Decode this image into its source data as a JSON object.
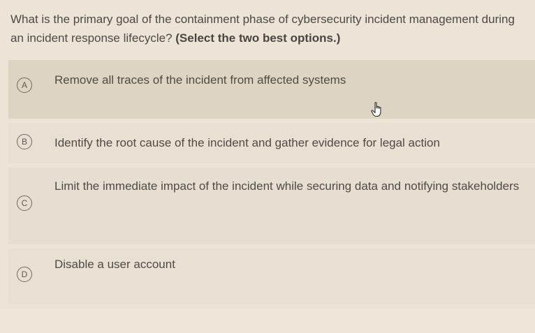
{
  "question": {
    "text": "What is the primary goal of the containment phase of cybersecurity incident management during an incident response lifecycle?",
    "hint": "(Select the two best options.)"
  },
  "options": [
    {
      "letter": "A",
      "text": "Remove all traces of the incident from affected systems"
    },
    {
      "letter": "B",
      "text": "Identify the root cause of the incident and gather evidence for legal action"
    },
    {
      "letter": "C",
      "text": "Limit the immediate impact of the incident while securing data and notifying stakeholders"
    },
    {
      "letter": "D",
      "text": "Disable a user account"
    }
  ],
  "cursor": {
    "icon": "hand-pointer-icon"
  },
  "colors": {
    "background": "#ebe4d7",
    "hovered_option": "#ddd4c4",
    "text": "#4a463f"
  }
}
